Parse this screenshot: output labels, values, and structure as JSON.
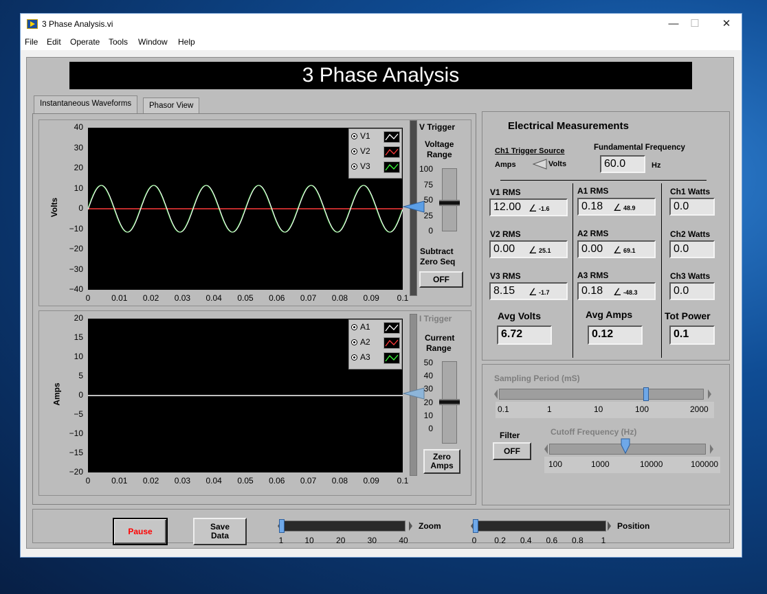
{
  "window": {
    "title": "3 Phase Analysis.vi",
    "minimize": "—",
    "maximize": "☐",
    "close": "✕"
  },
  "menu": [
    "File",
    "Edit",
    "Operate",
    "Tools",
    "Window",
    "Help"
  ],
  "banner": "3 Phase Analysis",
  "tabs": [
    "Instantaneous Waveforms",
    "Phasor View"
  ],
  "voltage_graph": {
    "ylabel": "Volts",
    "yticks": [
      "40",
      "30",
      "20",
      "10",
      "0",
      "−10",
      "−20",
      "−30",
      "−40"
    ],
    "xticks": [
      "0",
      "0.01",
      "0.02",
      "0.03",
      "0.04",
      "0.05",
      "0.06",
      "0.07",
      "0.08",
      "0.09",
      "0.1"
    ],
    "legend": [
      "V1",
      "V2",
      "V3"
    ],
    "trigger_label": "V Trigger",
    "range_label_1": "Voltage",
    "range_label_2": "Range",
    "range_ticks": [
      "100",
      "75",
      "50",
      "25",
      "0"
    ],
    "subtract_label_1": "Subtract",
    "subtract_label_2": "Zero Seq",
    "subtract_button": "OFF"
  },
  "current_graph": {
    "ylabel": "Amps",
    "yticks": [
      "20",
      "15",
      "10",
      "5",
      "0",
      "−5",
      "−10",
      "−15",
      "−20"
    ],
    "xticks": [
      "0",
      "0.01",
      "0.02",
      "0.03",
      "0.04",
      "0.05",
      "0.06",
      "0.07",
      "0.08",
      "0.09",
      "0.1"
    ],
    "legend": [
      "A1",
      "A2",
      "A3"
    ],
    "trigger_label": "I Trigger",
    "range_label_1": "Current",
    "range_label_2": "Range",
    "range_ticks": [
      "50",
      "40",
      "30",
      "20",
      "10",
      "0"
    ],
    "zero_button_1": "Zero",
    "zero_button_2": "Amps"
  },
  "measurements": {
    "title": "Electrical Measurements",
    "trigger_source": "Ch1 Trigger Source",
    "trigger_amps": "Amps",
    "trigger_volts": "Volts",
    "fundamental_label": "Fundamental Frequency",
    "fundamental_value": "60.0",
    "fundamental_unit": "Hz",
    "v_rms": [
      {
        "label": "V1 RMS",
        "value": "12.00",
        "phase": "-1.6"
      },
      {
        "label": "V2 RMS",
        "value": "0.00",
        "phase": "25.1"
      },
      {
        "label": "V3 RMS",
        "value": "8.15",
        "phase": "-1.7"
      }
    ],
    "a_rms": [
      {
        "label": "A1 RMS",
        "value": "0.18",
        "phase": "48.9"
      },
      {
        "label": "A2 RMS",
        "value": "0.00",
        "phase": "69.1"
      },
      {
        "label": "A3 RMS",
        "value": "0.18",
        "phase": "-48.3"
      }
    ],
    "watts": [
      {
        "label": "Ch1 Watts",
        "value": "0.0"
      },
      {
        "label": "Ch2 Watts",
        "value": "0.0"
      },
      {
        "label": "Ch3 Watts",
        "value": "0.0"
      }
    ],
    "avg_volts_label": "Avg Volts",
    "avg_volts": "6.72",
    "avg_amps_label": "Avg Amps",
    "avg_amps": "0.12",
    "tot_power_label": "Tot Power",
    "tot_power": "0.1"
  },
  "sampling": {
    "label": "Sampling Period (mS)",
    "ticks": [
      "0.1",
      "1",
      "10",
      "100",
      "2000"
    ],
    "value": 100
  },
  "filter": {
    "label": "Filter",
    "button": "OFF",
    "cutoff_label": "Cutoff Frequency (Hz)",
    "ticks": [
      "100",
      "1000",
      "10000",
      "100000"
    ],
    "value": 3000
  },
  "bottom": {
    "pause": "Pause",
    "save_1": "Save",
    "save_2": "Data",
    "zoom_label": "Zoom",
    "zoom_ticks": [
      "1",
      "10",
      "20",
      "30",
      "40"
    ],
    "zoom_value": 1,
    "position_label": "Position",
    "position_ticks": [
      "0",
      "0.2",
      "0.4",
      "0.6",
      "0.8",
      "1"
    ],
    "position_value": 0
  },
  "colors": {
    "v1": "#ffffff",
    "v2": "#ff3b3b",
    "v3": "#3bff3b",
    "pause_text": "#ff0000"
  }
}
